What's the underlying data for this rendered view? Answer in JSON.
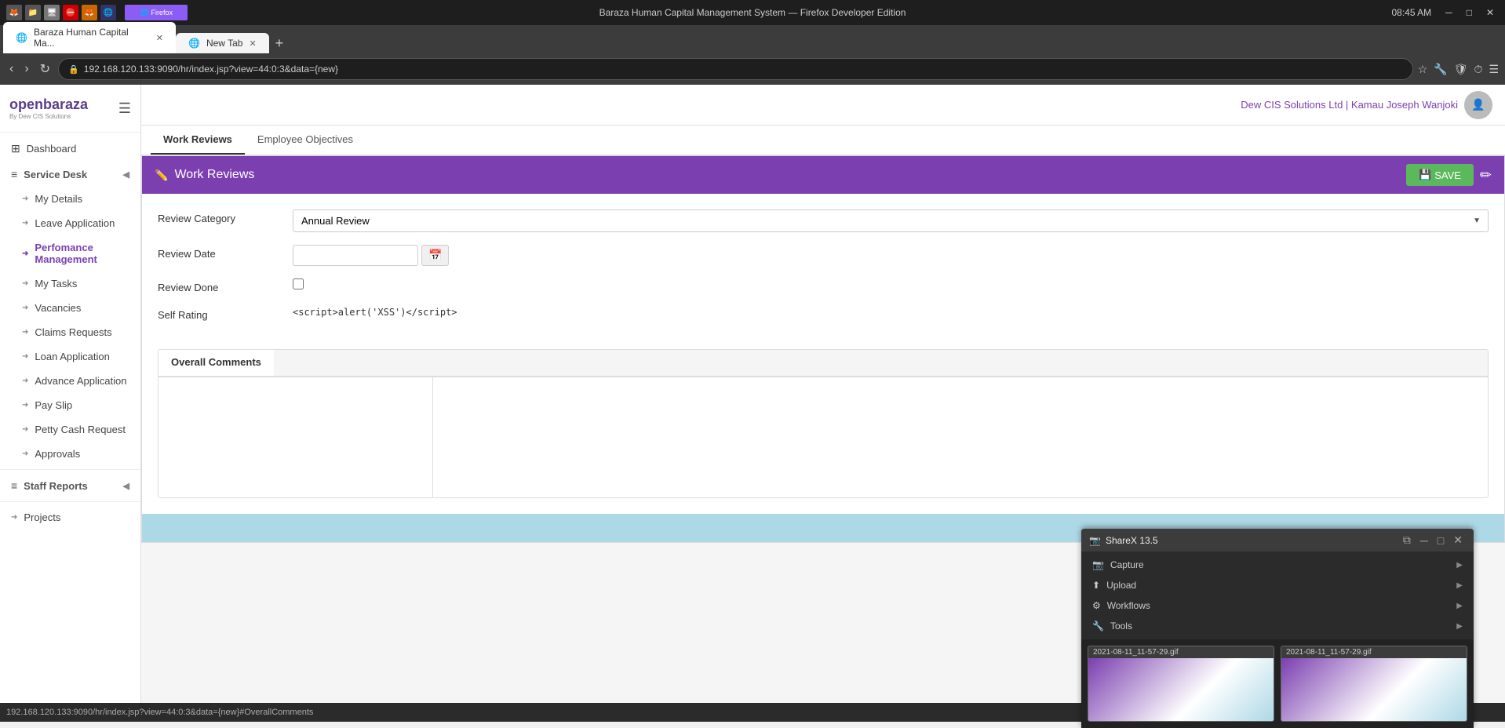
{
  "browser": {
    "title": "Baraza Human Capital Management System — Firefox Developer Edition",
    "tab1_label": "Baraza Human Capital Ma...",
    "tab2_label": "New Tab",
    "address": "192.168.120.133:9090/hr/index.jsp?view=44:0:3&data={new}",
    "time": "08:45 AM"
  },
  "app": {
    "title": "Baraza Human Capital Management System",
    "user": "Dew CIS Solutions Ltd | Kamau Joseph Wanjoki"
  },
  "sidebar": {
    "logo_text": "openbaraza",
    "logo_sub": "By Dew CIS Solutions",
    "dashboard_label": "Dashboard",
    "service_desk_label": "Service Desk",
    "my_details_label": "My Details",
    "leave_application_label": "Leave Application",
    "performance_label": "Perfomance Management",
    "my_tasks_label": "My Tasks",
    "vacancies_label": "Vacancies",
    "claims_label": "Claims Requests",
    "loan_label": "Loan Application",
    "advance_label": "Advance Application",
    "pay_slip_label": "Pay Slip",
    "petty_cash_label": "Petty Cash Request",
    "approvals_label": "Approvals",
    "staff_reports_label": "Staff Reports",
    "projects_label": "Projects"
  },
  "header": {
    "tab_work_reviews": "Work Reviews",
    "tab_employee_objectives": "Employee Objectives"
  },
  "form": {
    "title": "Work Reviews",
    "save_label": "SAVE",
    "review_category_label": "Review Category",
    "review_category_value": "Annual Review",
    "review_date_label": "Review Date",
    "review_done_label": "Review Done",
    "self_rating_label": "Self Rating",
    "self_rating_value": "<script>alert('XSS')</script>",
    "overall_comments_tab": "Overall Comments"
  },
  "sharex": {
    "title": "ShareX 13.5",
    "capture_label": "Capture",
    "upload_label": "Upload",
    "workflows_label": "Workflows",
    "tools_label": "Tools",
    "thumb1_label": "2021-08-11_11-57-29.gif",
    "thumb2_label": "2021-08-11_11-57-29.gif"
  },
  "statusbar": {
    "url": "192.168.120.133:9090/hr/index.jsp?view=44:0:3&data={new}#OverallComments"
  }
}
